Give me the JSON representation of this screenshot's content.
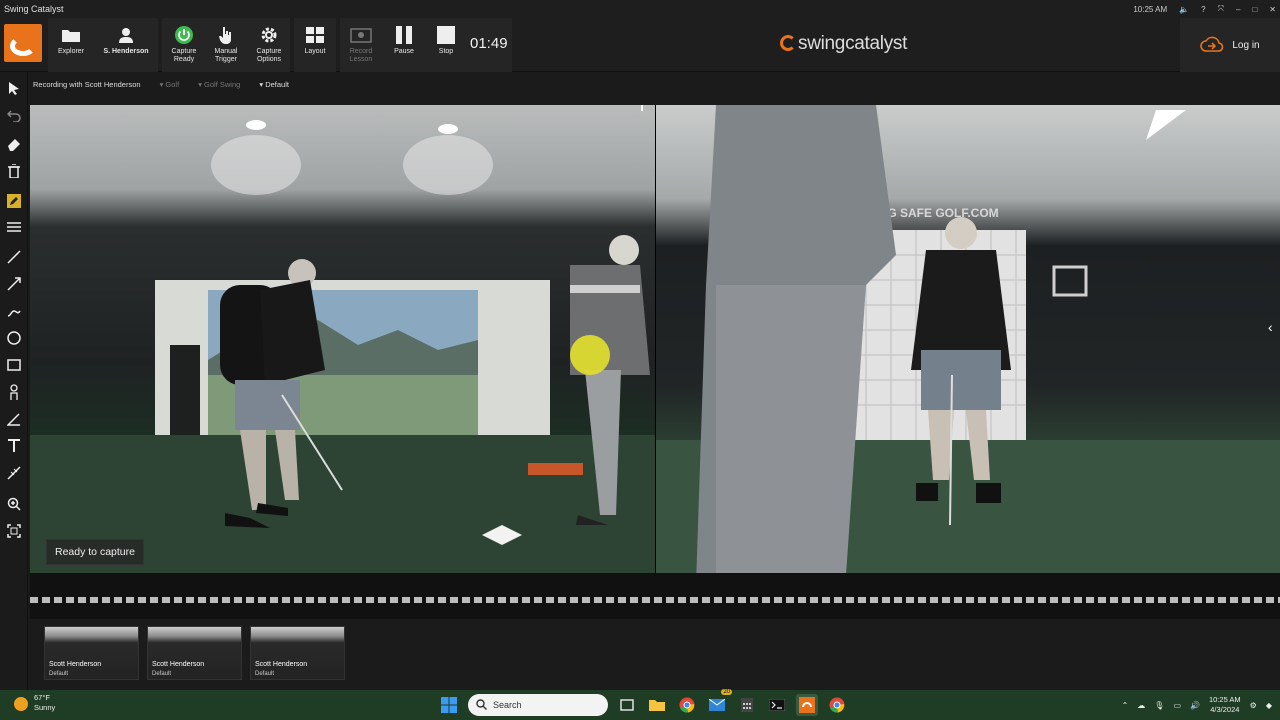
{
  "window": {
    "title": "Swing Catalyst",
    "system_time": "10:25 AM",
    "controls": [
      "?",
      "–",
      "□",
      "✕"
    ]
  },
  "toolbar": {
    "explorer_label": "Explorer",
    "user_label": "S. Henderson",
    "capture_ready_label": [
      "Capture",
      "Ready"
    ],
    "manual_trigger_label": [
      "Manual",
      "Trigger"
    ],
    "capture_options_label": [
      "Capture",
      "Options"
    ],
    "layout_label": "Layout",
    "record_lesson_label": [
      "Record",
      "Lesson"
    ],
    "pause_label": "Pause",
    "stop_label": "Stop",
    "timer": "01:49",
    "brand_swing": "swing",
    "brand_catalyst": "catalyst",
    "login_label": "Log in",
    "accent_color": "#e8731a",
    "ready_color": "#3fb950"
  },
  "session": {
    "recording_with": "Recording with Scott Henderson",
    "sport": "Golf",
    "activity": "Golf Swing",
    "profile": "Default"
  },
  "video": {
    "status_button": "Ready to capture",
    "info_icon": "i",
    "wall_sign": "SWING SAFE GOLF.COM"
  },
  "thumbnails": [
    {
      "name": "Scott Henderson",
      "profile": "Default"
    },
    {
      "name": "Scott Henderson",
      "profile": "Default"
    },
    {
      "name": "Scott Henderson",
      "profile": "Default"
    }
  ],
  "taskbar": {
    "temperature": "67°F",
    "weather": "Sunny",
    "search_placeholder": "Search",
    "badge": "20",
    "time": "10:25 AM",
    "date": "4/3/2024"
  }
}
